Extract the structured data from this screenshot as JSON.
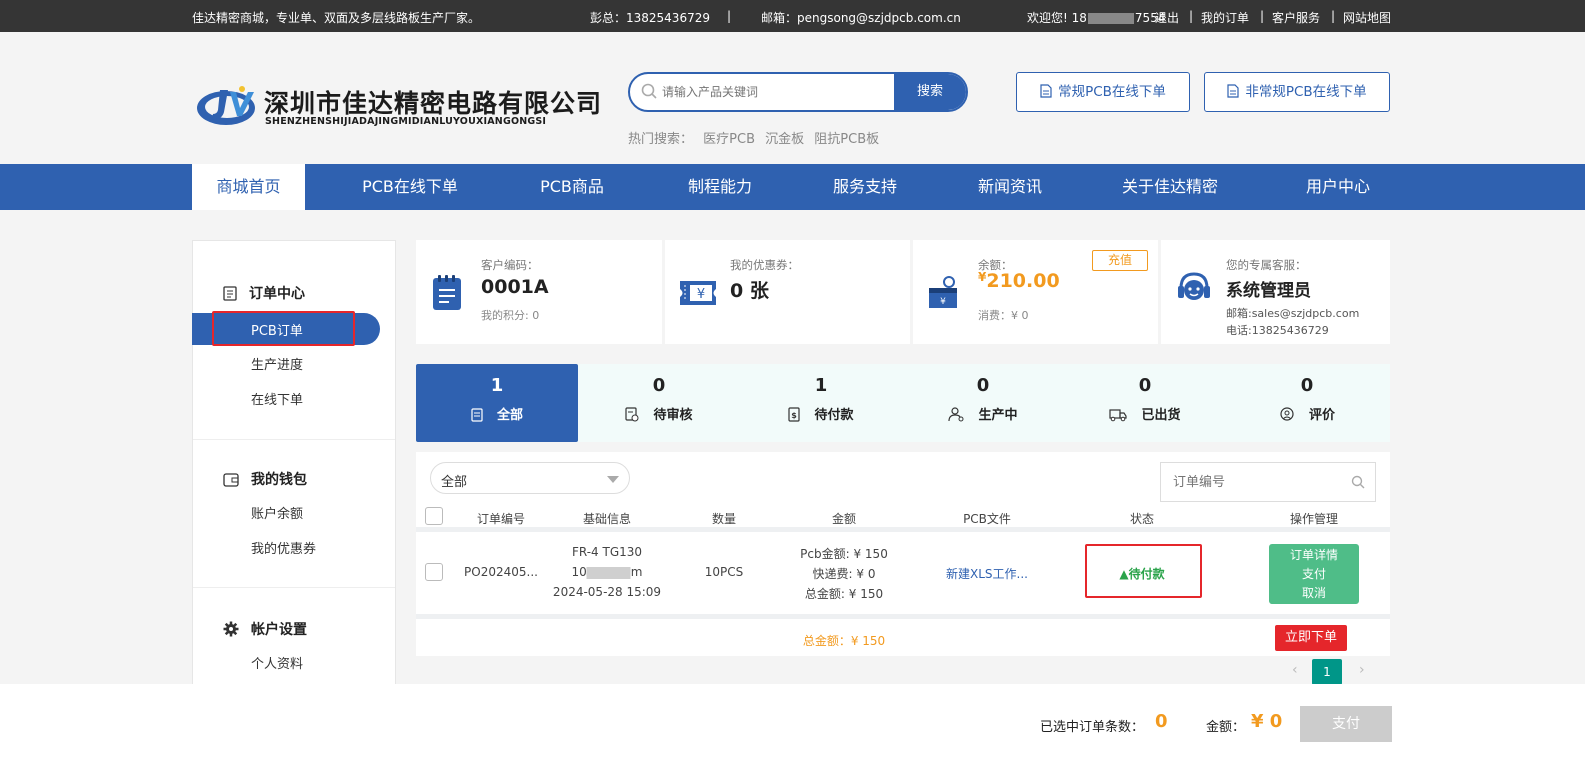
{
  "topbar": {
    "slogan": "佳达精密商城，专业单、双面及多层线路板生产厂家。",
    "contact_name_phone": "彭总：13825436729",
    "sep": "|",
    "email": "邮箱：pengsong@szjdpcb.com.cn",
    "welcome": "欢迎您!",
    "user_phone_start": "18",
    "user_phone_end": "7554",
    "logout": "退出",
    "my_orders": "我的订单",
    "customer_service": "客户服务",
    "site_map": "网站地图",
    "divider": "|"
  },
  "header": {
    "company_cn": "深圳市佳达精密电路有限公司",
    "company_en": "SHENZHENSHIJIADAJINGMIDIANLUYOUXIANGONGSI",
    "search_placeholder": "请输入产品关键词",
    "search_button": "搜索",
    "hot_label": "热门搜索：",
    "hot_terms": [
      "医疗PCB",
      "沉金板",
      "阻抗PCB板"
    ],
    "btn_regular": "常规PCB在线下单",
    "btn_irregular": "非常规PCB在线下单"
  },
  "nav": [
    "商城首页",
    "PCB在线下单",
    "PCB商品",
    "制程能力",
    "服务支持",
    "新闻资讯",
    "关于佳达精密",
    "用户中心"
  ],
  "sidebar": {
    "order_center": "订单中心",
    "order_items": [
      "PCB订单",
      "生产进度",
      "在线下单"
    ],
    "wallet": "我的钱包",
    "wallet_items": [
      "账户余额",
      "我的优惠券"
    ],
    "account": "帐户设置",
    "account_items": [
      "个人资料"
    ]
  },
  "cards": {
    "customer_code_label": "客户编码：",
    "customer_code": "0001A",
    "points": "我的积分: 0",
    "coupon_label": "我的优惠券：",
    "coupon_value": "0 张",
    "balance_label": "余额：",
    "balance_value": "210.00",
    "balance_currency": "¥",
    "recharge": "充值",
    "consumption": "消费：¥ 0",
    "service_label": "您的专属客服：",
    "service_name": "系统管理员",
    "service_email": "邮箱:sales@szjdpcb.com",
    "service_phone": "电话:13825436729"
  },
  "tabs": [
    {
      "num": "1",
      "label": "全部"
    },
    {
      "num": "0",
      "label": "待审核"
    },
    {
      "num": "1",
      "label": "待付款"
    },
    {
      "num": "0",
      "label": "生产中"
    },
    {
      "num": "0",
      "label": "已出货"
    },
    {
      "num": "0",
      "label": "评价"
    }
  ],
  "table": {
    "filter_value": "全部",
    "order_search_placeholder": "订单编号",
    "headers": [
      "订单编号",
      "基础信息",
      "数量",
      "金额",
      "PCB文件",
      "状态",
      "操作管理"
    ],
    "row": {
      "order_no": "PO202405...",
      "info_line1": "FR-4 TG130",
      "info_line2_start": "10",
      "info_line2_end": "m",
      "info_line3": "2024-05-28 15:09",
      "qty": "10PCS",
      "amount_pcb": "Pcb金额: ¥ 150",
      "amount_ship": "快递费: ¥ 0",
      "amount_total": "总金额: ¥ 150",
      "file": "新建XLS工作...",
      "status": "▲待付款",
      "ops": [
        "订单详情",
        "支付",
        "取消"
      ]
    },
    "sum_total": "总金额：¥ 150",
    "order_now": "立即下单",
    "page": "1",
    "prev": "‹",
    "next": "›"
  },
  "bottom": {
    "selected_label": "已选中订单条数：",
    "selected_count": "0",
    "amount_label": "金额：",
    "amount_value": "¥ 0",
    "pay": "支付"
  },
  "colors": {
    "brand": "#2f61b0",
    "alert": "#e5262b",
    "accent": "#f29a1f",
    "success": "#4fbd88",
    "pager": "#009688"
  }
}
